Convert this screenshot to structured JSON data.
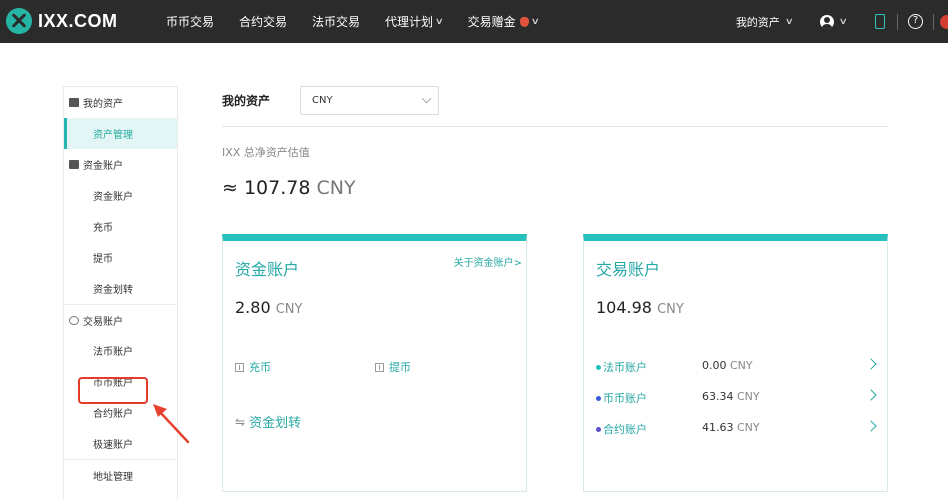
{
  "header": {
    "logo_text": "IXX.COM",
    "nav": [
      "币币交易",
      "合约交易",
      "法币交易",
      "代理计划",
      "交易赠金"
    ],
    "my_assets": "我的资产",
    "help_glyph": "?"
  },
  "sidebar": {
    "group_assets": "我的资产",
    "item_asset_mgmt": "资产管理",
    "group_fund": "资金账户",
    "item_fund_account": "资金账户",
    "item_deposit": "充币",
    "item_withdraw": "提币",
    "item_transfer": "资金划转",
    "group_trade": "交易账户",
    "item_fiat": "法币账户",
    "item_coin": "币币账户",
    "item_contract": "合约账户",
    "item_speed": "极速账户",
    "item_address": "地址管理"
  },
  "main": {
    "title": "我的资产",
    "currency": "CNY",
    "estimate_label": "IXX 总净资产估值",
    "estimate_prefix": "≈ ",
    "estimate_value": "107.78",
    "estimate_unit": "CNY"
  },
  "fund_card": {
    "title": "资金账户",
    "link": "关于资金账户>",
    "amount": "2.80",
    "unit": "CNY",
    "deposit": "充币",
    "withdraw": "提币",
    "swap_glyph": "⇋",
    "transfer": "资金划转"
  },
  "trade_card": {
    "title": "交易账户",
    "amount": "104.98",
    "unit": "CNY",
    "accounts": [
      {
        "name": "法币账户",
        "value": "0.00",
        "unit": "CNY",
        "dot_color": "#27c1bd"
      },
      {
        "name": "币币账户",
        "value": "63.34",
        "unit": "CNY",
        "dot_color": "#3b5bd6"
      },
      {
        "name": "合约账户",
        "value": "41.63",
        "unit": "CNY",
        "dot_color": "#5b4fc9"
      }
    ]
  },
  "colors": {
    "accent": "#27c1bd",
    "highlight": "#e23b2a",
    "topbar": "#2b2b2b"
  }
}
